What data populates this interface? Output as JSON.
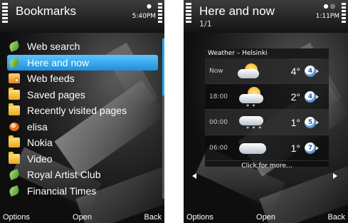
{
  "left": {
    "title": "Bookmarks",
    "clock": "5:40PM",
    "items": [
      {
        "label": "Web search",
        "icon": "bookmark-leaf-icon"
      },
      {
        "label": "Here and now",
        "icon": "bookmark-leaf-icon",
        "selected": true
      },
      {
        "label": "Web feeds",
        "icon": "feed-folder-icon"
      },
      {
        "label": "Saved pages",
        "icon": "folder-icon"
      },
      {
        "label": "Recently visited pages",
        "icon": "folder-icon"
      },
      {
        "label": "elisa",
        "icon": "operator-icon"
      },
      {
        "label": "Nokia",
        "icon": "folder-icon"
      },
      {
        "label": "Video",
        "icon": "folder-icon"
      },
      {
        "label": "Royal Artist Club",
        "icon": "bookmark-leaf-icon"
      },
      {
        "label": "Financial Times",
        "icon": "bookmark-leaf-icon"
      }
    ],
    "softkeys": {
      "left": "Options",
      "middle": "Open",
      "right": "Back"
    },
    "accent": "#2ea3f2"
  },
  "right": {
    "title": "Here and now",
    "subtitle": "1/1",
    "clock": "1:11PM",
    "widget": {
      "header": "Weather – Helsinki",
      "rows": [
        {
          "time": "Now",
          "temp": "4°",
          "badge": "4",
          "icon": "sun-cloud-icon"
        },
        {
          "time": "18:00",
          "temp": "2°",
          "badge": "4",
          "icon": "snow-cloud-icon"
        },
        {
          "time": "00:00",
          "temp": "1°",
          "badge": "5",
          "icon": "snow-cloud-icon"
        },
        {
          "time": "06:00",
          "temp": "1°",
          "badge": "7",
          "icon": "cloud-icon"
        }
      ],
      "footer": "Click for more..."
    },
    "softkeys": {
      "left": "Options",
      "middle": "Open",
      "right": "Back"
    }
  }
}
